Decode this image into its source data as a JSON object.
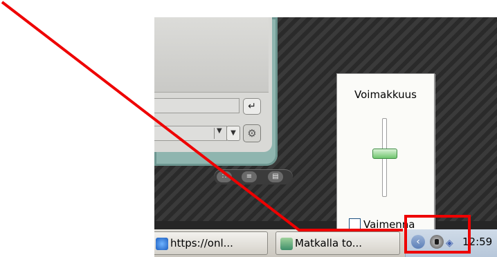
{
  "volume": {
    "title": "Voimakkuus",
    "level": 0.55,
    "mute_label": "Vaimenna",
    "muted": false
  },
  "player": {
    "go_icon": "enter-arrow-icon",
    "dropdown_icon": "chevron-down-icon",
    "settings_icon": "gear-icon",
    "view_buttons": [
      "grid-view-icon",
      "list-view-icon",
      "detail-view-icon"
    ]
  },
  "taskbar": {
    "tasks": [
      {
        "label": "https://onl...",
        "icon": "internet-explorer-icon"
      },
      {
        "label": "Matkalla to...",
        "icon": "photo-viewer-icon"
      }
    ],
    "tray_icons": [
      "show-hidden-icons-icon",
      "speaker-icon",
      "network-icon"
    ],
    "clock": "12:59"
  },
  "annotation": {
    "color": "#ee0000",
    "highlight_target": "system-tray-volume"
  }
}
